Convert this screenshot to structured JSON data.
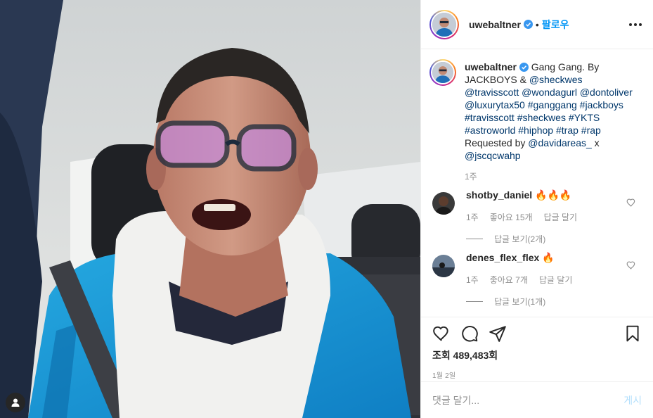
{
  "header": {
    "username": "uwebaltner",
    "dot": "•",
    "follow_label": "팔로우"
  },
  "caption": {
    "username": "uwebaltner",
    "parts": [
      {
        "t": "Gang Gang. By JACKBOYS & ",
        "hl": false
      },
      {
        "t": "@sheckwes",
        "hl": true
      },
      {
        "t": " ",
        "hl": false
      },
      {
        "t": "@travisscott",
        "hl": true
      },
      {
        "t": " ",
        "hl": false
      },
      {
        "t": "@wondagurl",
        "hl": true
      },
      {
        "t": " ",
        "hl": false
      },
      {
        "t": "@dontoliver",
        "hl": true
      },
      {
        "t": " ",
        "hl": false
      },
      {
        "t": "@luxurytax50",
        "hl": true
      },
      {
        "t": " ",
        "hl": false
      },
      {
        "t": "#ganggang",
        "hl": true
      },
      {
        "t": " ",
        "hl": false
      },
      {
        "t": "#jackboys",
        "hl": true
      },
      {
        "t": " ",
        "hl": false
      },
      {
        "t": "#travisscott",
        "hl": true
      },
      {
        "t": " ",
        "hl": false
      },
      {
        "t": "#sheckwes",
        "hl": true
      },
      {
        "t": " ",
        "hl": false
      },
      {
        "t": "#YKTS",
        "hl": true
      },
      {
        "t": " ",
        "hl": false
      },
      {
        "t": "#astroworld",
        "hl": true
      },
      {
        "t": " ",
        "hl": false
      },
      {
        "t": "#hiphop",
        "hl": true
      },
      {
        "t": " ",
        "hl": false
      },
      {
        "t": "#trap",
        "hl": true
      },
      {
        "t": " ",
        "hl": false
      },
      {
        "t": "#rap",
        "hl": true
      },
      {
        "t": " Requested by ",
        "hl": false
      },
      {
        "t": "@davidareas_",
        "hl": true
      },
      {
        "t": " x ",
        "hl": false
      },
      {
        "t": "@jscqcwahp",
        "hl": true
      }
    ],
    "time": "1주"
  },
  "comments": [
    {
      "username": "shotby_daniel",
      "text": "🔥🔥🔥",
      "time": "1주",
      "likes": "좋아요 15개",
      "reply": "답글 달기",
      "view_replies": "답글 보기(2개)"
    },
    {
      "username": "denes_flex_flex",
      "text": "🔥",
      "time": "1주",
      "likes": "좋아요 7개",
      "reply": "답글 달기",
      "view_replies": "답글 보기(1개)"
    }
  ],
  "views_label": "조회",
  "views_count": "489,483회",
  "date": "1월 2일",
  "add_comment": {
    "placeholder": "댓글 달기...",
    "post_label": "게시"
  },
  "colors": {
    "accent": "#0095f6",
    "link": "#00376b",
    "muted": "#8e8e8e",
    "post_disabled": "#b2dffc"
  },
  "icons": [
    "more-options-icon",
    "verified-badge-icon",
    "heart-icon",
    "comment-icon",
    "share-icon",
    "bookmark-icon",
    "user-tag-icon",
    "small-heart-icon"
  ]
}
